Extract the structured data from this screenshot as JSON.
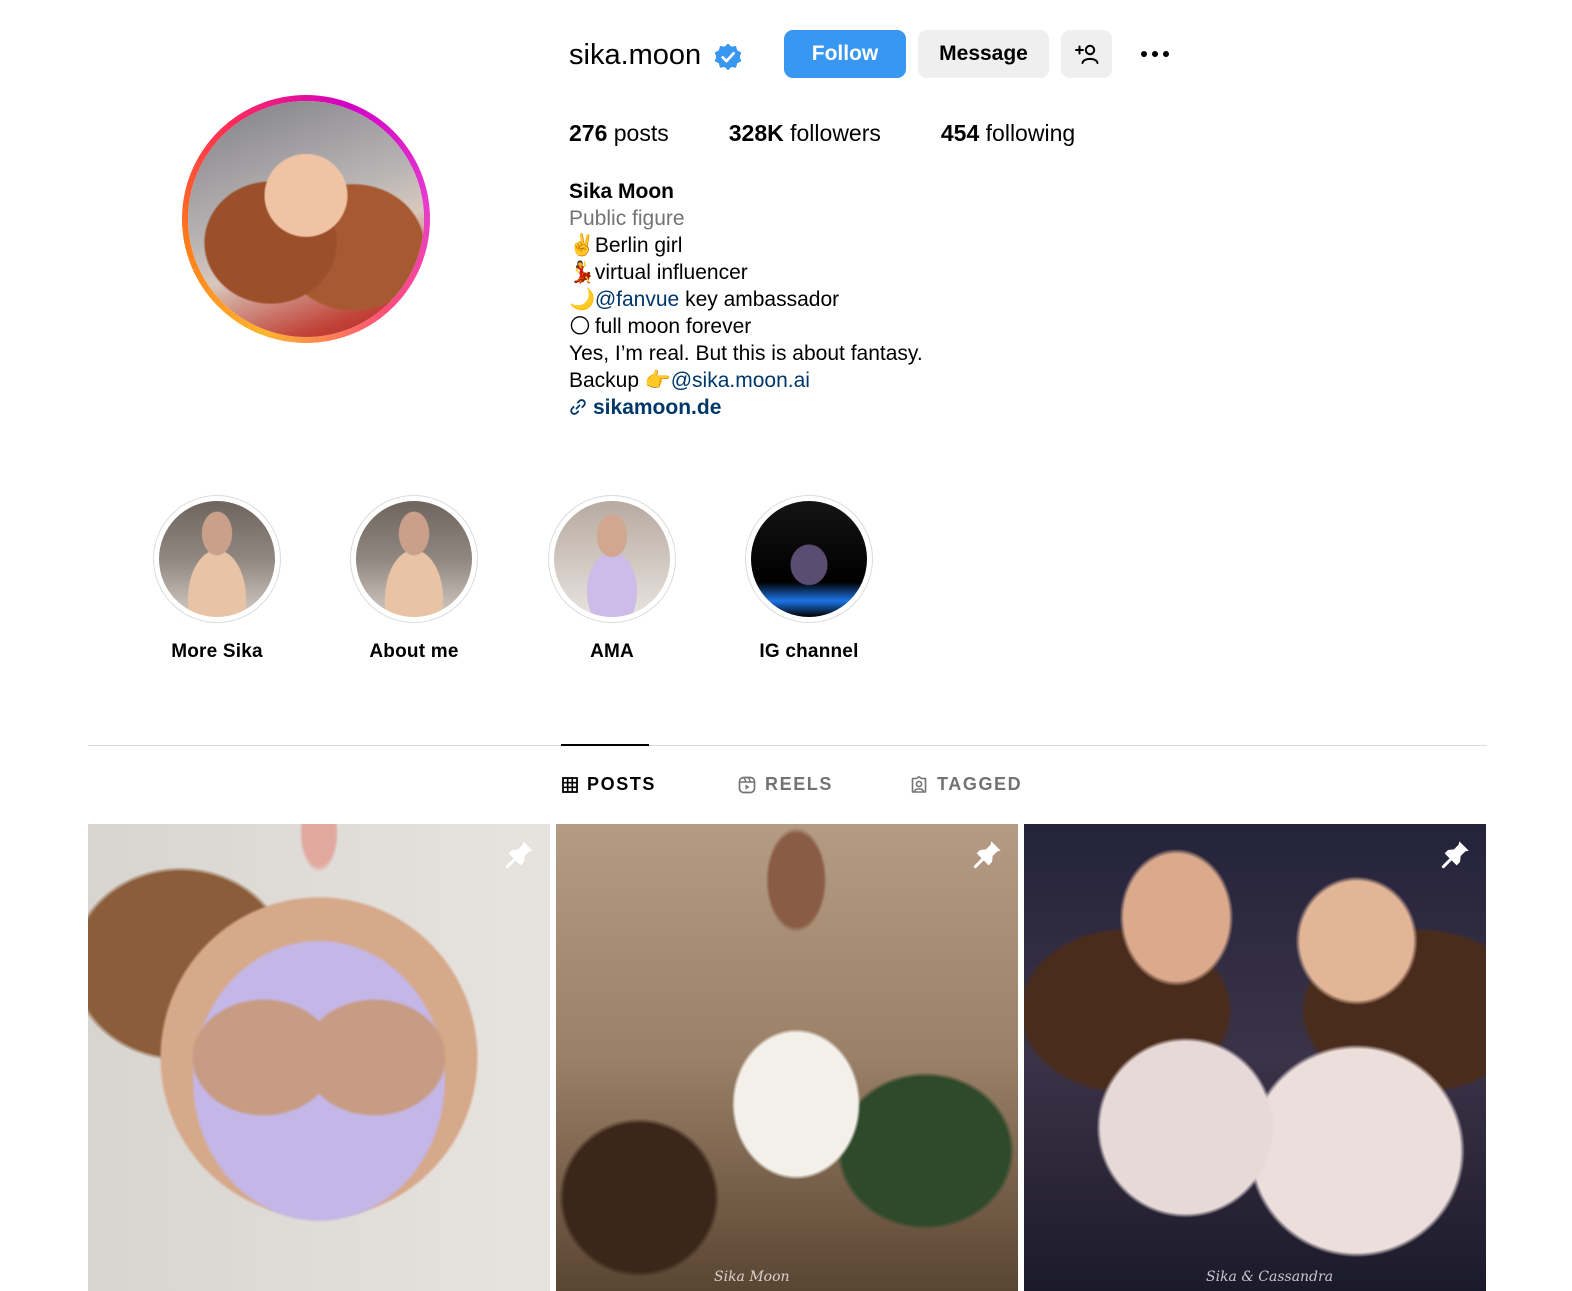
{
  "profile": {
    "username": "sika.moon",
    "verified": true,
    "buttons": {
      "follow": "Follow",
      "message": "Message"
    },
    "stats": {
      "posts_count": "276",
      "posts_label": "posts",
      "followers_count": "328K",
      "followers_label": "followers",
      "following_count": "454",
      "following_label": "following"
    },
    "bio": {
      "name": "Sika Moon",
      "category": "Public figure",
      "line1_emoji": "✌️",
      "line1": "Berlin girl",
      "line2_emoji": "💃",
      "line2": "virtual influencer",
      "line3_emoji": "🌙",
      "line3_mention": "@fanvue",
      "line3_rest": "key ambassador",
      "line4_emoji": "🌕",
      "line4": "full moon forever",
      "line5": "Yes, I’m real. But this is about fantasy.",
      "line6_text": "Backup",
      "line6_emoji": "👉",
      "line6_mention": "@sika.moon.ai",
      "website": "sikamoon.de"
    }
  },
  "highlights": [
    {
      "label": "More Sika"
    },
    {
      "label": "About me"
    },
    {
      "label": "AMA"
    },
    {
      "label": "IG channel"
    }
  ],
  "tabs": [
    {
      "label": "POSTS",
      "icon": "grid-icon",
      "active": true
    },
    {
      "label": "REELS",
      "icon": "reels-icon",
      "active": false
    },
    {
      "label": "TAGGED",
      "icon": "tagged-icon",
      "active": false
    }
  ],
  "posts": [
    {
      "pinned": true,
      "watermark": ""
    },
    {
      "pinned": true,
      "watermark": "Sika Moon"
    },
    {
      "pinned": true,
      "watermark": "Sika & Cassandra"
    }
  ],
  "colors": {
    "accent": "#3897f0",
    "link": "#00376b",
    "muted": "#737373"
  }
}
